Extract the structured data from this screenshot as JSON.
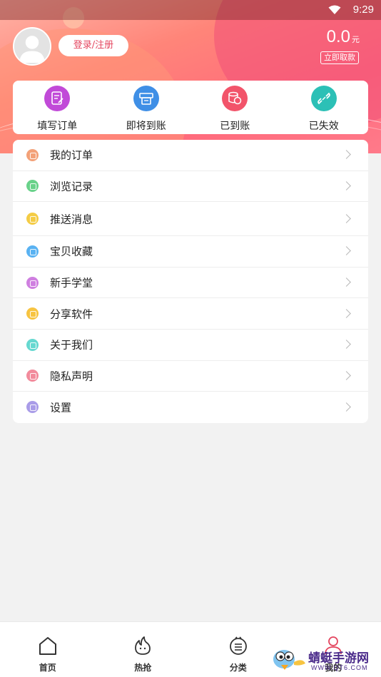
{
  "status": {
    "time": "9:29",
    "wifi_icon": "wifi-icon"
  },
  "profile": {
    "avatar_icon": "avatar-placeholder-icon",
    "login_label": "登录/注册",
    "balance": "0.0",
    "balance_unit": "元",
    "withdraw_label": "立即取款"
  },
  "orders": [
    {
      "label": "填写订单",
      "icon": "edit-order-icon",
      "color": "#c14ad8"
    },
    {
      "label": "即将到账",
      "icon": "printer-icon",
      "color": "#3f8fe6"
    },
    {
      "label": "已到账",
      "icon": "coins-icon",
      "color": "#f2546a"
    },
    {
      "label": "已失效",
      "icon": "broken-link-icon",
      "color": "#2cc0b6"
    }
  ],
  "menu": [
    {
      "label": "我的订单",
      "icon": "order-icon",
      "color": "#f3a178"
    },
    {
      "label": "浏览记录",
      "icon": "history-icon",
      "color": "#69d28a"
    },
    {
      "label": "推送消息",
      "icon": "bell-icon",
      "color": "#f4cc45"
    },
    {
      "label": "宝贝收藏",
      "icon": "heart-icon",
      "color": "#59b2f2"
    },
    {
      "label": "新手学堂",
      "icon": "book-icon",
      "color": "#cf7fe0"
    },
    {
      "label": "分享软件",
      "icon": "share-icon",
      "color": "#f7c441"
    },
    {
      "label": "关于我们",
      "icon": "info-icon",
      "color": "#66d8d0"
    },
    {
      "label": "隐私声明",
      "icon": "lock-icon",
      "color": "#f28b9c"
    },
    {
      "label": "设置",
      "icon": "settings-icon",
      "color": "#a99ce8"
    }
  ],
  "tabs": [
    {
      "label": "首页",
      "icon": "home-icon"
    },
    {
      "label": "热抢",
      "icon": "flame-icon"
    },
    {
      "label": "分类",
      "icon": "category-icon"
    },
    {
      "label": "我的",
      "icon": "user-icon"
    }
  ],
  "watermark": {
    "text": "蜻蜓手游网",
    "url": "WWW.QT6.COM"
  }
}
